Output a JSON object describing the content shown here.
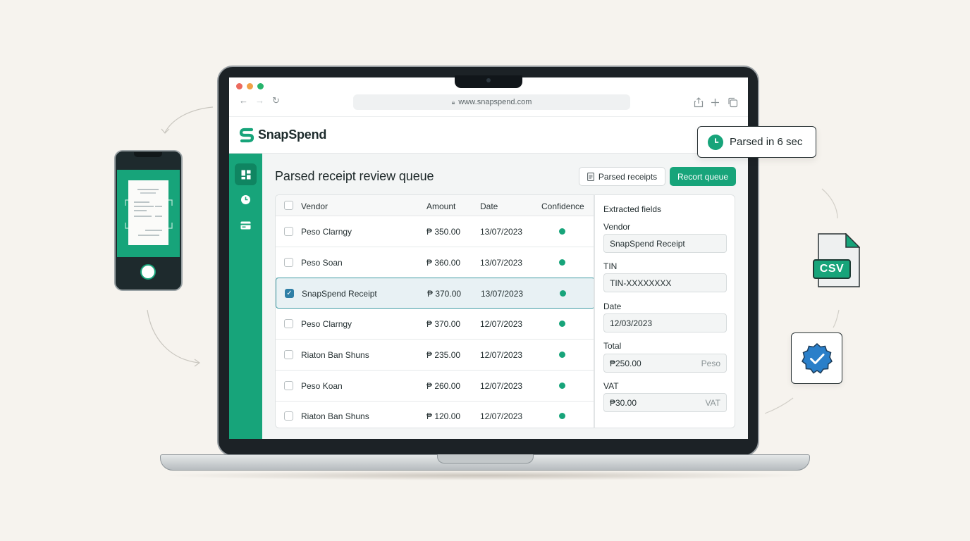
{
  "browser": {
    "url": "www.snapspend.com",
    "traffic_colors": [
      "#ec6a5e",
      "#f0a146",
      "#27b46c"
    ]
  },
  "app": {
    "brand": "SnapSpend",
    "accent": "#17a47a"
  },
  "sidebar": {
    "items": [
      {
        "icon": "dashboard-icon",
        "active": true
      },
      {
        "icon": "clock-icon",
        "active": false
      },
      {
        "icon": "card-icon",
        "active": false
      }
    ]
  },
  "main": {
    "title": "Parsed receipt review queue",
    "buttons": {
      "parsed_receipts": "Parsed receipts",
      "export_queue": "Recort queue"
    },
    "table": {
      "columns": [
        "Vendor",
        "Amount",
        "Date",
        "Confidence"
      ],
      "rows": [
        {
          "vendor": "Peso Clarngy",
          "amount": "₱ 350.00",
          "date": "13/07/2023",
          "checked": false
        },
        {
          "vendor": "Peso Soan",
          "amount": "₱ 360.00",
          "date": "13/07/2023",
          "checked": false
        },
        {
          "vendor": "SnapSpend Receipt",
          "amount": "₱ 370.00",
          "date": "13/07/2023",
          "checked": true
        },
        {
          "vendor": "Peso Clarngy",
          "amount": "₱ 370.00",
          "date": "12/07/2023",
          "checked": false
        },
        {
          "vendor": "Riaton Ban Shuns",
          "amount": "₱ 235.00",
          "date": "12/07/2023",
          "checked": false
        },
        {
          "vendor": "Peso Koan",
          "amount": "₱ 260.00",
          "date": "12/07/2023",
          "checked": false
        },
        {
          "vendor": "Riaton Ban Shuns",
          "amount": "₱ 120.00",
          "date": "12/07/2023",
          "checked": false
        }
      ]
    },
    "fields": {
      "title": "Extracted fields",
      "vendor_label": "Vendor",
      "vendor_value": "SnapSpend Receipt",
      "tin_label": "TIN",
      "tin_value": "TIN-XXXXXXXX",
      "date_label": "Date",
      "date_value": "12/03/2023",
      "total_label": "Total",
      "total_value": "₱250.00",
      "total_suffix": "Peso",
      "vat_label": "VAT",
      "vat_value": "₱30.00",
      "vat_suffix": "VAT"
    }
  },
  "toast": {
    "text": "Parsed in 6 sec"
  },
  "badges": {
    "csv": "CSV"
  }
}
